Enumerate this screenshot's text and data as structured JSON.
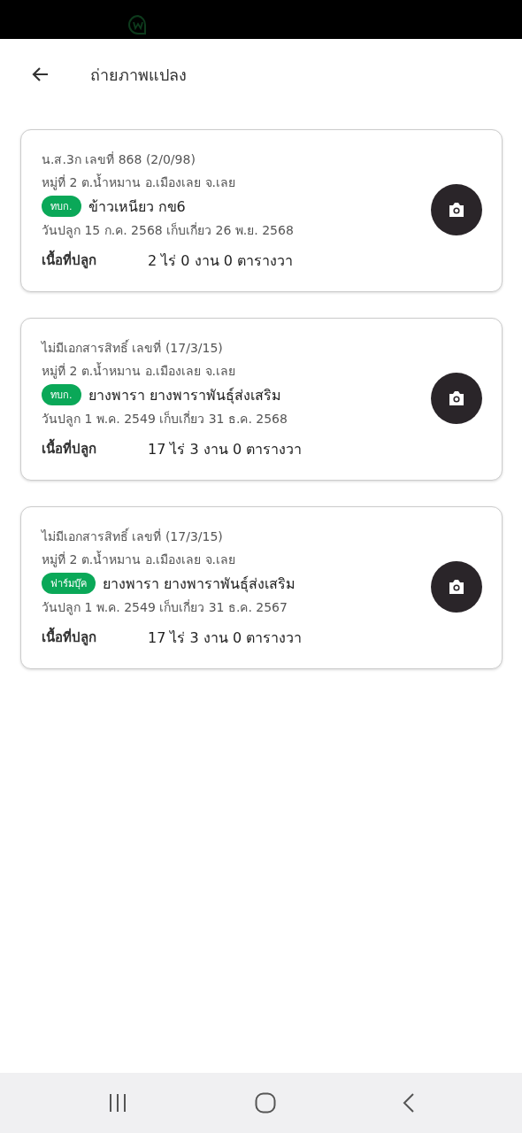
{
  "header": {
    "title": "ถ่ายภาพแปลง"
  },
  "plots": [
    {
      "document": "น.ส.3ก เลขที่ 868 (2/0/98)",
      "location": "หมู่ที่ 2 ต.น้ำหมาน อ.เมืองเลย จ.เลย",
      "tag": "ทบก.",
      "crop": "ข้าวเหนียว กข6",
      "dates": "วันปลูก 15 ก.ค. 2568 เก็บเกี่ยว 26 พ.ย. 2568",
      "area_label": "เนื้อที่ปลูก",
      "area": "2 ไร่ 0 งาน 0 ตารางวา"
    },
    {
      "document": "ไม่มีเอกสารสิทธิ์ เลขที่ (17/3/15)",
      "location": "หมู่ที่ 2 ต.น้ำหมาน อ.เมืองเลย จ.เลย",
      "tag": "ทบก.",
      "crop": "ยางพารา ยางพาราพันธุ์ส่งเสริม",
      "dates": "วันปลูก 1 พ.ค. 2549 เก็บเกี่ยว 31 ธ.ค. 2568",
      "area_label": "เนื้อที่ปลูก",
      "area": "17 ไร่ 3 งาน 0 ตารางวา"
    },
    {
      "document": "ไม่มีเอกสารสิทธิ์ เลขที่ (17/3/15)",
      "location": "หมู่ที่ 2 ต.น้ำหมาน อ.เมืองเลย จ.เลย",
      "tag": "ฟาร์มบุ๊ค",
      "crop": "ยางพารา ยางพาราพันธุ์ส่งเสริม",
      "dates": "วันปลูก 1 พ.ค. 2549 เก็บเกี่ยว 31 ธ.ค. 2567",
      "area_label": "เนื้อที่ปลูก",
      "area": "17 ไร่ 3 งาน 0 ตารางวา"
    }
  ]
}
